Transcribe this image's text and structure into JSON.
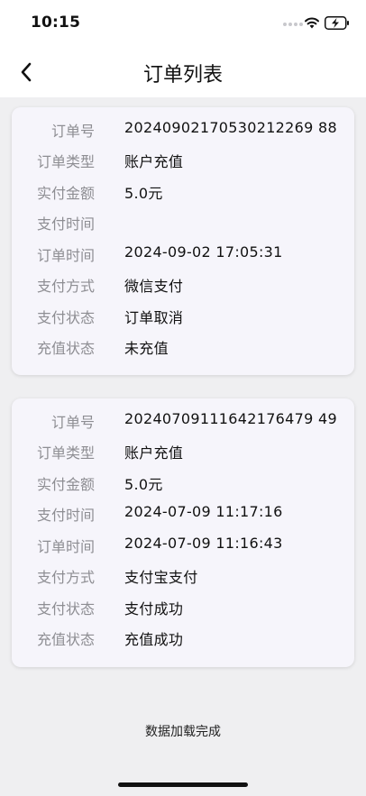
{
  "status_bar": {
    "time": "10:15"
  },
  "nav": {
    "title": "订单列表"
  },
  "orders": [
    {
      "rows": [
        {
          "label": "订单号",
          "value": "20240902170530212269 88"
        },
        {
          "label": "订单类型",
          "value": "账户充值"
        },
        {
          "label": "实付金额",
          "value": "5.0元"
        },
        {
          "label": "支付时间",
          "value": ""
        },
        {
          "label": "订单时间",
          "value": "2024-09-02 17:05:31"
        },
        {
          "label": "支付方式",
          "value": "微信支付"
        },
        {
          "label": "支付状态",
          "value": "订单取消"
        },
        {
          "label": "充值状态",
          "value": "未充值"
        }
      ]
    },
    {
      "rows": [
        {
          "label": "订单号",
          "value": "20240709111642176479 49"
        },
        {
          "label": "订单类型",
          "value": "账户充值"
        },
        {
          "label": "实付金额",
          "value": "5.0元"
        },
        {
          "label": "支付时间",
          "value": "2024-07-09 11:17:16"
        },
        {
          "label": "订单时间",
          "value": "2024-07-09 11:16:43"
        },
        {
          "label": "支付方式",
          "value": "支付宝支付"
        },
        {
          "label": "支付状态",
          "value": "支付成功"
        },
        {
          "label": "充值状态",
          "value": "充值成功"
        }
      ]
    }
  ],
  "footer": {
    "text": "数据加载完成"
  },
  "icons": {
    "back": "chevron-left-icon",
    "wifi": "wifi-icon",
    "battery": "battery-charging-icon",
    "signal": "signal-icon"
  }
}
